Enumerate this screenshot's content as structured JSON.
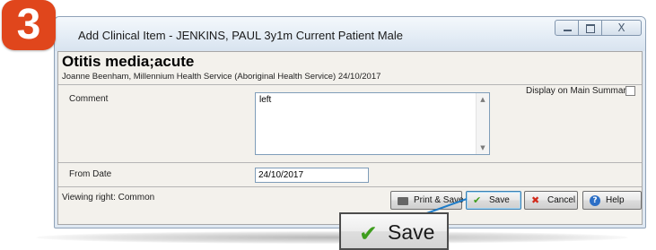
{
  "step_number": "3",
  "window": {
    "title": "Add Clinical Item - JENKINS, PAUL 3y1m Current Patient Male",
    "controls": {
      "minimize": "minimize",
      "maximize": "maximize",
      "close": "X"
    }
  },
  "item": {
    "title": "Otitis media;acute",
    "author_line": "Joanne Beenham, Millennium Health Service (Aboriginal Health Service) 24/10/2017"
  },
  "comment": {
    "label": "Comment",
    "value": "left"
  },
  "display_on_main_summary": {
    "label": "Display on Main Summary",
    "checked": false
  },
  "from_date": {
    "label": "From Date",
    "value": "24/10/2017"
  },
  "status": {
    "viewing_right": "Viewing right: Common"
  },
  "buttons": {
    "print_save": "Print & Save",
    "save": "Save",
    "cancel": "Cancel",
    "help": "Help"
  },
  "callout": {
    "save_label": "Save"
  },
  "icons": {
    "print": "printer-icon",
    "save": "checkmark-icon",
    "cancel": "x-icon",
    "help": "help-icon"
  },
  "colors": {
    "badge": "#e0461c",
    "save_check": "#3e9d1d",
    "cancel_x": "#d22a1a",
    "help_blue": "#2c6fc6"
  }
}
